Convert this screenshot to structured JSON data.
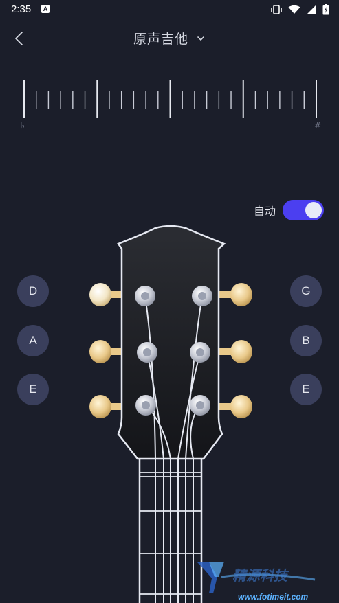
{
  "status_bar": {
    "time": "2:35",
    "app_icon_letter": "A",
    "icons": [
      "vibrate-icon",
      "wifi-icon",
      "signal-icon",
      "battery-icon"
    ]
  },
  "header": {
    "title": "原声吉他",
    "back_icon": "chevron-left-icon",
    "dropdown_icon": "chevron-down-icon"
  },
  "tuner": {
    "flat_symbol": "♭",
    "sharp_symbol": "#",
    "tick_count": 25
  },
  "auto": {
    "label": "自动",
    "enabled": true,
    "accent_color": "#4b3ff0"
  },
  "strings": {
    "left": [
      "D",
      "A",
      "E"
    ],
    "right": [
      "G",
      "B",
      "E"
    ]
  },
  "watermark": {
    "text": "精源科技",
    "url": "www.fotimeit.com"
  },
  "colors": {
    "background": "#1b1e2a",
    "button": "#3a3f5c",
    "peg": "#e9c98a"
  }
}
